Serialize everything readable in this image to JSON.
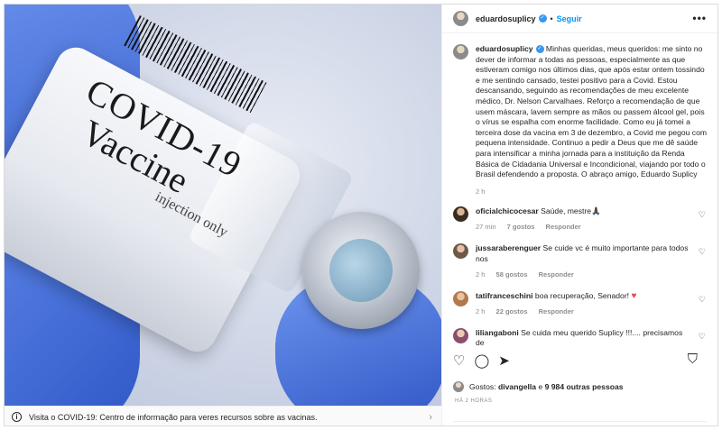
{
  "media": {
    "vial_label_1": "COVID-19",
    "vial_label_2": "Vaccine",
    "vial_label_3": "injection only",
    "info_text": "Visita o COVID-19: Centro de informação para veres recursos sobre as vacinas."
  },
  "header": {
    "username": "eduardosuplicy",
    "separator": "•",
    "follow_label": "Seguir",
    "more_label": "•••"
  },
  "caption": {
    "username": "eduardosuplicy",
    "text": "Minhas queridas, meus queridos: me sinto no dever de informar a todas as pessoas, especialmente as que estiveram comigo nos últimos dias, que após estar ontem tossindo e me sentindo cansado, testei positivo para a Covid. Estou descansando, seguindo as recomendações de meu excelente médico, Dr. Nelson Carvalhaes. Reforço a recomendação de que usem máscara, lavem sempre as mãos ou passem álcool gel, pois o vírus se espalha com enorme facilidade. Como eu já tomei a terceira dose da vacina em 3 de dezembro, a Covid me pegou com pequena intensidade. Continuo a pedir a Deus que me dê saúde para intensificar a minha jornada para a instituição da Renda Básica de Cidadania Universal e Incondicional, viajando por todo o Brasil defendendo a proposta. O abraço amigo, Eduardo Suplicy",
    "time": "2 h"
  },
  "comments": [
    {
      "user": "oficialchicocesar",
      "text": "Saúde, mestre🙏🏿",
      "time": "27 min",
      "likes": "7 gostos",
      "reply": "Responder"
    },
    {
      "user": "jussaraberenguer",
      "text": "Se cuide vc é muito importante para todos nos",
      "time": "2 h",
      "likes": "58 gostos",
      "reply": "Responder"
    },
    {
      "user": "tatifranceschini",
      "text": "boa recuperação, Senador!",
      "time": "2 h",
      "likes": "22 gostos",
      "reply": "Responder"
    },
    {
      "user": "liliangaboni",
      "text": "Se cuida meu querido Suplicy !!!.... precisamos de",
      "time": "",
      "likes": "",
      "reply": ""
    }
  ],
  "likes": {
    "prefix": "Gostos:",
    "user": "divangella",
    "connector": "e",
    "others": "9 984 outras pessoas"
  },
  "post_time": "HÁ 2 HORAS",
  "colors": {
    "accent": "#0095f6",
    "verified": "#3897f0",
    "heart_red": "#ed4956",
    "text": "#262626",
    "muted": "#8e8e8e"
  }
}
